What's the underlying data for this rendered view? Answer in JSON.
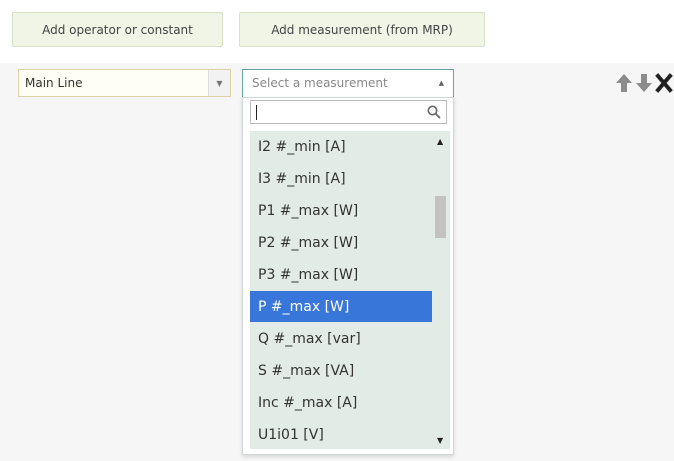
{
  "toolbar": {
    "add_operator_label": "Add operator or constant",
    "add_measurement_label": "Add measurement (from MRP)"
  },
  "line_select": {
    "value": "Main Line"
  },
  "measurement_select": {
    "placeholder": "Select a measurement",
    "search_value": ""
  },
  "options": [
    {
      "label": "I2 #_min [A]",
      "selected": false
    },
    {
      "label": "I3 #_min [A]",
      "selected": false
    },
    {
      "label": "P1 #_max [W]",
      "selected": false
    },
    {
      "label": "P2 #_max [W]",
      "selected": false
    },
    {
      "label": "P3 #_max [W]",
      "selected": false
    },
    {
      "label": "P #_max [W]",
      "selected": true
    },
    {
      "label": "Q #_max [var]",
      "selected": false
    },
    {
      "label": "S #_max [VA]",
      "selected": false
    },
    {
      "label": "Inc #_max [A]",
      "selected": false
    },
    {
      "label": "U1i01 [V]",
      "selected": false
    }
  ],
  "icons": {
    "move_up": "arrow-up-icon",
    "move_down": "arrow-down-icon",
    "remove": "close-icon"
  },
  "colors": {
    "selected_bg": "#3876d9",
    "list_bg": "#e3ebe7",
    "button_bg": "#f0f5e6"
  }
}
